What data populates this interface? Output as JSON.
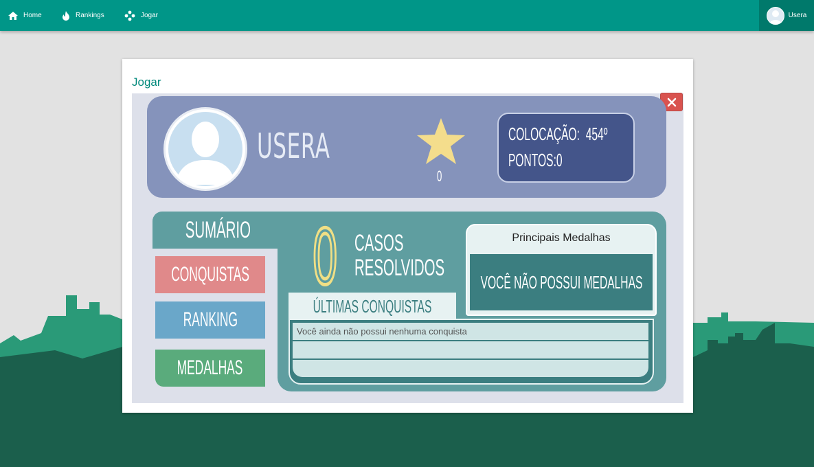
{
  "nav": {
    "items": [
      {
        "label": "Home",
        "icon": "home-icon"
      },
      {
        "label": "Rankings",
        "icon": "fire-icon"
      },
      {
        "label": "Jogar",
        "icon": "gamepad-icon"
      }
    ],
    "user": {
      "label": "Usera",
      "icon": "user-avatar-icon"
    }
  },
  "card": {
    "title": "Jogar"
  },
  "game": {
    "close_icon": "close-icon",
    "profile": {
      "username": "USERA",
      "star_count": "0",
      "rank_label": "COLOCAÇÃO:",
      "rank_value": "454º",
      "points_label": "PONTOS:",
      "points_value": "0"
    },
    "menu": {
      "summary_label": "SUMÁRIO",
      "achievements_label": "CONQUISTAS",
      "ranking_label": "RANKING",
      "medals_label": "MEDALHAS"
    },
    "summary": {
      "cases_count": "0",
      "cases_label_1": "CASOS",
      "cases_label_2": "RESOLVIDOS",
      "medals_title": "Principais Medalhas",
      "no_medals": "VOCÊ NÃO POSSUI MEDALHAS",
      "last_achievements_title": "ÚLTIMAS CONQUISTAS",
      "achievements_rows": [
        "Você ainda não possui nenhuma conquista",
        "",
        ""
      ]
    }
  },
  "colors": {
    "topbar": "#009688",
    "profile_bg": "#8593bb",
    "rank_box": "#44558a",
    "panel": "#5f9ea0",
    "achievements_btn": "#e0898a",
    "ranking_btn": "#6aa7c9",
    "medals_btn": "#5aab7c",
    "star": "#f4dd8c",
    "close": "#d9534f"
  }
}
